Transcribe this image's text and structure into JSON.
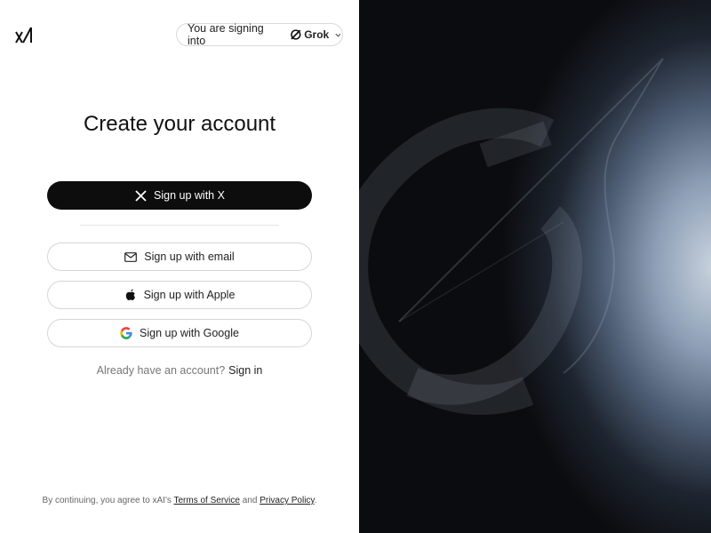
{
  "brand": {
    "logo_icon": "xai-logo-icon"
  },
  "signing_into": {
    "prefix": "You are signing into",
    "app_name": "Grok",
    "app_icon": "grok-icon",
    "dropdown_icon": "chevron-down-icon"
  },
  "heading": "Create your account",
  "buttons": {
    "x": {
      "label": "Sign up with X",
      "icon": "x-logo-icon"
    },
    "email": {
      "label": "Sign up with email",
      "icon": "mail-icon"
    },
    "apple": {
      "label": "Sign up with Apple",
      "icon": "apple-icon"
    },
    "google": {
      "label": "Sign up with Google",
      "icon": "google-icon"
    }
  },
  "signin": {
    "prompt": "Already have an account?",
    "link": "Sign in"
  },
  "legal": {
    "prefix": "By continuing, you agree to xAI's",
    "tos": "Terms of Service",
    "and": "and",
    "privacy": "Privacy Policy",
    "suffix": "."
  },
  "colors": {
    "primary_button": "#0d0d0d",
    "panel_dark": "#0b0c0f",
    "accent_glow": "#8d9fb6"
  }
}
